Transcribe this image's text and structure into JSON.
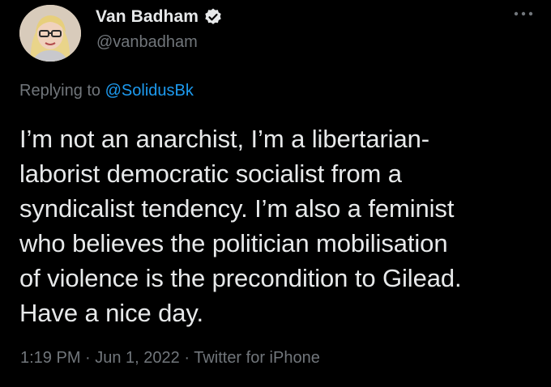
{
  "author": {
    "display_name": "Van Badham",
    "handle": "@vanbadham",
    "verified_icon": "verified-badge-icon",
    "avatar": "profile-avatar"
  },
  "reply": {
    "prefix": "Replying to ",
    "mention": "@SolidusBk"
  },
  "tweet": {
    "lines": [
      "I’m not an anarchist, I’m a libertarian-",
      "laborist democratic socialist from a",
      "syndicalist tendency. I’m also a feminist",
      "who believes the politician mobilisation",
      "of violence is the precondition to Gilead.",
      "Have a nice day."
    ]
  },
  "meta": {
    "timestamp": "1:19 PM · Jun 1, 2022 · Twitter for iPhone"
  },
  "icons": {
    "more": "more-options-icon"
  },
  "colors": {
    "background": "#000000",
    "text": "#e7e9ea",
    "secondary": "#71767b",
    "link": "#1d9bf0"
  }
}
